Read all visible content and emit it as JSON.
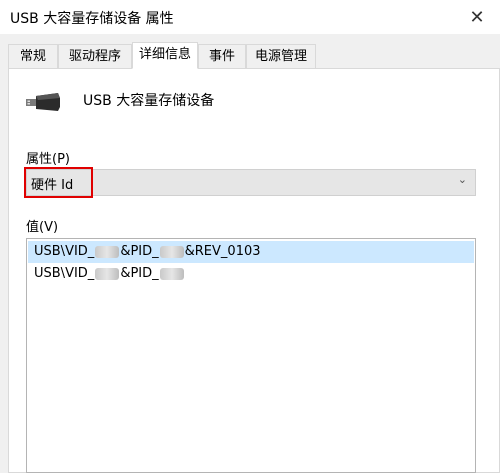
{
  "window": {
    "title": "USB 大容量存储设备 属性",
    "close_glyph": "✕"
  },
  "tabs": [
    {
      "label": "常规"
    },
    {
      "label": "驱动程序"
    },
    {
      "label": "详细信息",
      "active": true
    },
    {
      "label": "事件"
    },
    {
      "label": "电源管理"
    }
  ],
  "device": {
    "name": "USB 大容量存储设备",
    "icon": "usb-device-icon"
  },
  "property": {
    "label": "属性(P)",
    "selected": "硬件 Id"
  },
  "value": {
    "label": "值(V)",
    "items": [
      {
        "parts": [
          "USB\\VID_",
          "&PID_",
          "&REV_0103"
        ]
      },
      {
        "parts": [
          "USB\\VID_",
          "&PID_",
          ""
        ]
      }
    ]
  },
  "colors": {
    "selection": "#cce8ff",
    "highlight": "#e00000"
  }
}
